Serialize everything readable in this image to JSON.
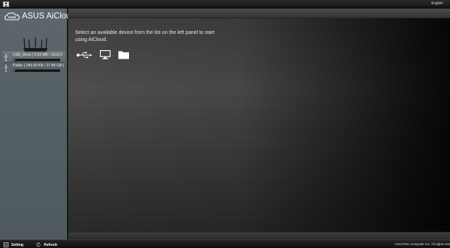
{
  "app": {
    "logo_text": "ASUS AiCloud",
    "language": "English",
    "icons": {
      "user": "user-icon",
      "cloud": "cloud-logo-icon",
      "router": "router-icon"
    }
  },
  "sidebar": {
    "devices": [
      {
        "label": "USB_Drive ( 5.53 MB / 1015.5",
        "usage": 0.006,
        "icon": "usb-icon",
        "selected": true
      },
      {
        "label": "Public ( 240.00 KB / 27.88 GB )",
        "usage": 0.0001,
        "icon": "usb-icon",
        "selected": false
      }
    ]
  },
  "main": {
    "instruction": "Select an available device from the list on the left panel to start using AiCloud.",
    "device_types": [
      {
        "name": "usb-device-icon"
      },
      {
        "name": "computer-icon"
      },
      {
        "name": "folder-icon"
      }
    ]
  },
  "footer": {
    "setting_label": "Setting",
    "refresh_label": "Refresh",
    "copyright": "ASUSTeK Computer Inc. All rights reserved.",
    "icons": {
      "setting": "setting-icon",
      "refresh": "refresh-icon"
    }
  },
  "colors": {
    "sidebar": "#59636a",
    "main_bg": "#3f3f3f",
    "topbar": "#1f1f1f",
    "text": "#ffffff"
  }
}
